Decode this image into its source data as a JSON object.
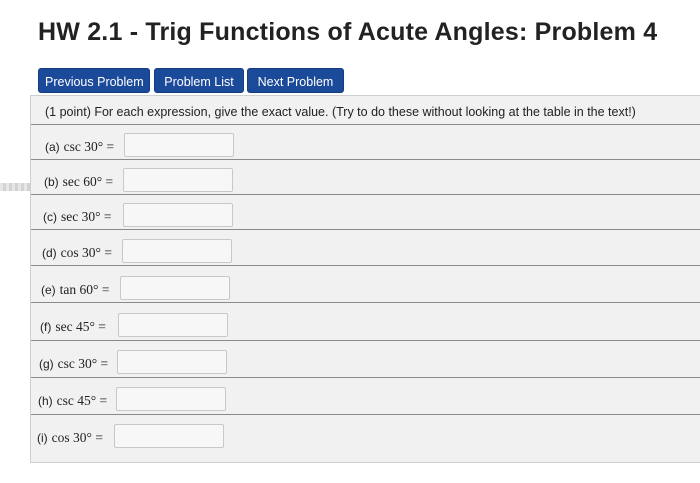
{
  "header": {
    "title": "HW 2.1 - Trig Functions of Acute Angles: Problem 4"
  },
  "nav": {
    "previous_label": "Previous Problem",
    "list_label": "Problem List",
    "next_label": "Next Problem"
  },
  "problem": {
    "intro": "(1 point) For each expression, give the exact value. (Try to do these without looking at the table in the text!)",
    "rows": [
      {
        "letter": "(a)",
        "expr": "csc 30° =",
        "value": ""
      },
      {
        "letter": "(b)",
        "expr": "sec 60° =",
        "value": ""
      },
      {
        "letter": "(c)",
        "expr": "sec 30° =",
        "value": ""
      },
      {
        "letter": "(d)",
        "expr": "cos 30° =",
        "value": ""
      },
      {
        "letter": "(e)",
        "expr": "tan 60° =",
        "value": ""
      },
      {
        "letter": "(f)",
        "expr": "sec 45° =",
        "value": ""
      },
      {
        "letter": "(g)",
        "expr": "csc 30° =",
        "value": ""
      },
      {
        "letter": "(h)",
        "expr": "csc 45° =",
        "value": ""
      },
      {
        "letter": "(i)",
        "expr": "cos 30° =",
        "value": ""
      }
    ]
  },
  "colors": {
    "button_bg": "#1c4a9a",
    "button_text": "#ffffff",
    "panel_bg": "#f1f1f1"
  }
}
